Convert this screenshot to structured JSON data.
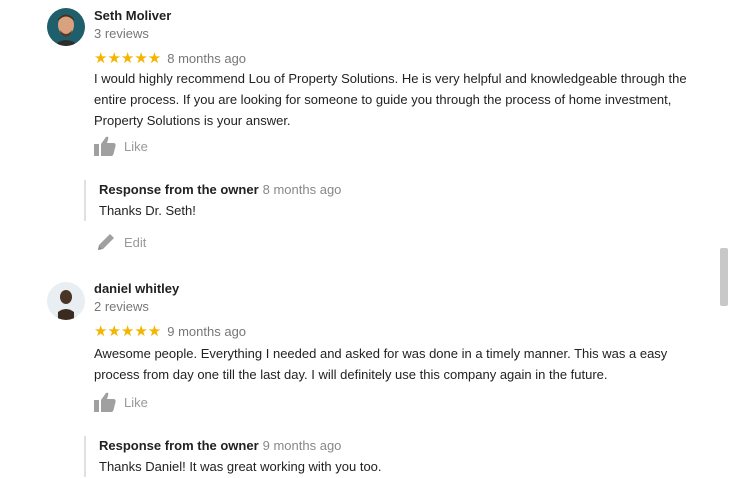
{
  "reviews": [
    {
      "name": "Seth Moliver",
      "count": "3 reviews",
      "stars": "★★★★★",
      "ago": "8 months ago",
      "text": "I would highly recommend Lou of Property Solutions. He is very helpful and knowledgeable through the entire process. If you are looking for someone to guide you through the process of home investment, Property Solutions is your answer.",
      "like_label": "Like",
      "response_title": "Response from the owner",
      "response_ago": "8 months ago",
      "response_text": "Thanks Dr. Seth!",
      "edit_label": "Edit"
    },
    {
      "name": "daniel whitley",
      "count": "2 reviews",
      "stars": "★★★★★",
      "ago": "9 months ago",
      "text": "Awesome people.  Everything I needed and asked for was done in a timely manner. This was a easy process from day one till the last day.  I will definitely use this company again in the future.",
      "like_label": "Like",
      "response_title": "Response from the owner",
      "response_ago": "9 months ago",
      "response_text": "Thanks Daniel! It was great working with you too."
    }
  ],
  "colors": {
    "star": "#f4b400",
    "muted": "#777777",
    "icon": "#a0a0a0"
  }
}
